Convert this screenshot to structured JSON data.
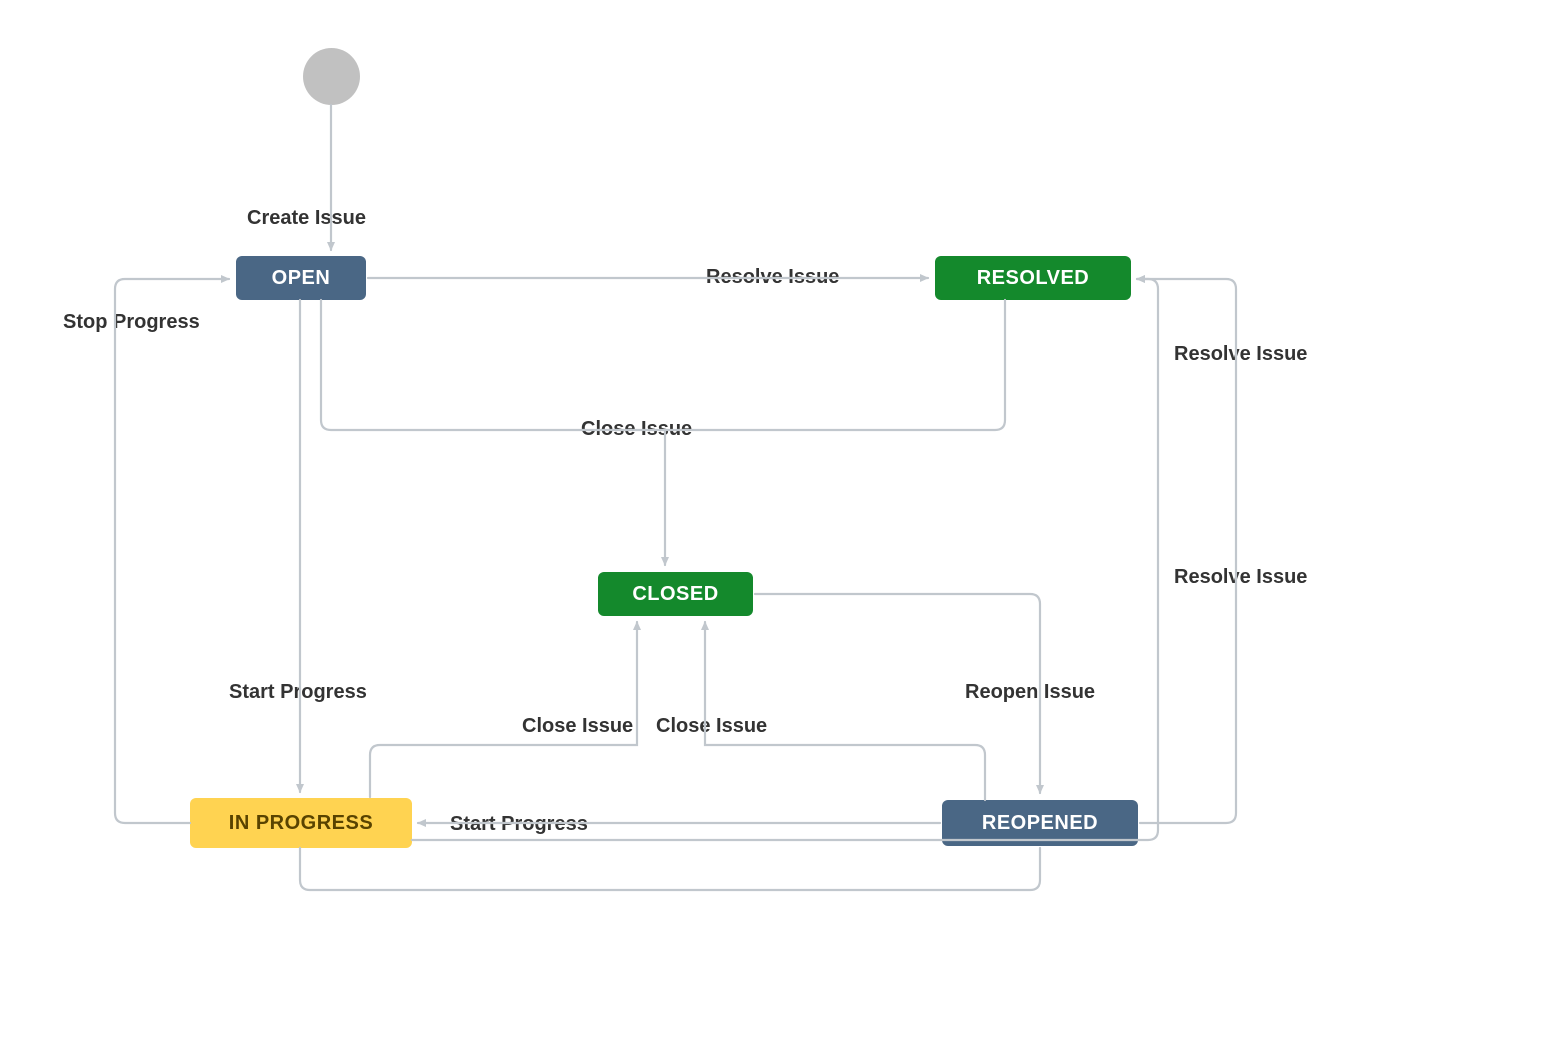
{
  "nodes": {
    "open": {
      "label": "OPEN"
    },
    "resolved": {
      "label": "RESOLVED"
    },
    "closed": {
      "label": "CLOSED"
    },
    "in_progress": {
      "label": "IN PROGRESS"
    },
    "reopened": {
      "label": "REOPENED"
    }
  },
  "transitions": {
    "create_issue": {
      "label": "Create Issue"
    },
    "resolve_issue_1": {
      "label": "Resolve Issue"
    },
    "resolve_issue_2": {
      "label": "Resolve Issue"
    },
    "resolve_issue_3": {
      "label": "Resolve Issue"
    },
    "stop_progress": {
      "label": "Stop Progress"
    },
    "close_issue_top": {
      "label": "Close Issue"
    },
    "close_issue_left": {
      "label": "Close Issue"
    },
    "close_issue_right": {
      "label": "Close Issue"
    },
    "start_progress_1": {
      "label": "Start Progress"
    },
    "start_progress_2": {
      "label": "Start Progress"
    },
    "reopen_issue": {
      "label": "Reopen Issue"
    }
  },
  "colors": {
    "line": "#c1c7cd",
    "arrow": "#c1c7cd",
    "text": "#333333"
  }
}
